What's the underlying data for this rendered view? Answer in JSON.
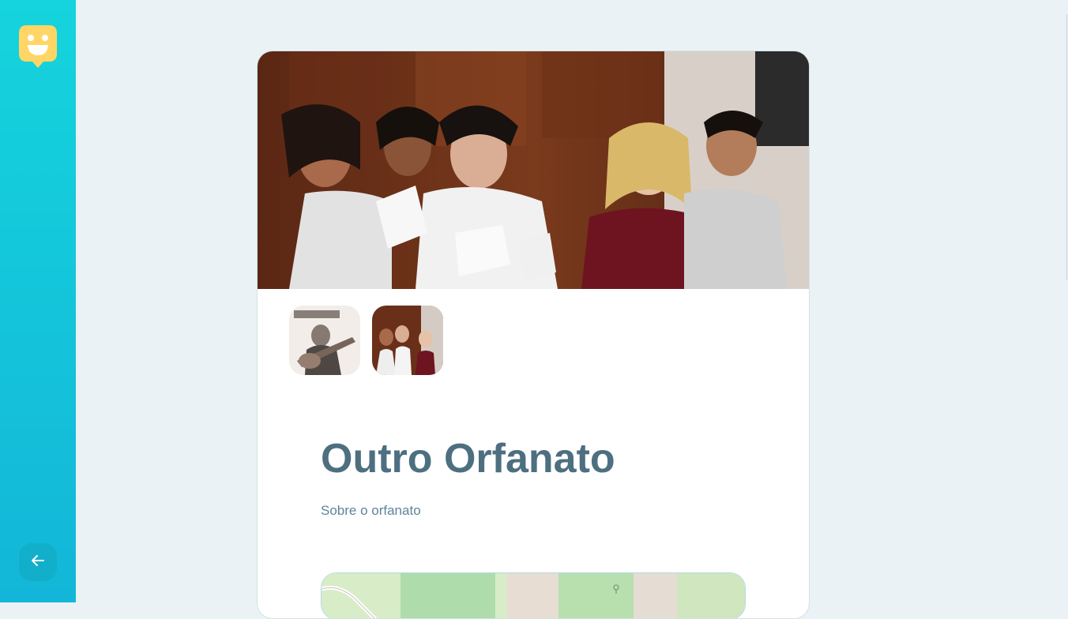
{
  "page": {
    "background_color": "#ebf2f5"
  },
  "sidebar": {
    "gradient_top": "#15d4dd",
    "gradient_bottom": "#13b6d8",
    "logo_icon": "happy-face-marker-icon",
    "logo_color": "#ffd666",
    "back_icon": "arrow-left-icon"
  },
  "orphanage": {
    "name": "Outro Orfanato",
    "about": "Sobre o orfanato",
    "hero_image": "photo-children-with-young-people-writing",
    "images": [
      {
        "icon": "photo-dia-do-violeiro-poster"
      },
      {
        "icon": "photo-children-group"
      }
    ]
  },
  "map": {
    "icon": "map-preview"
  }
}
